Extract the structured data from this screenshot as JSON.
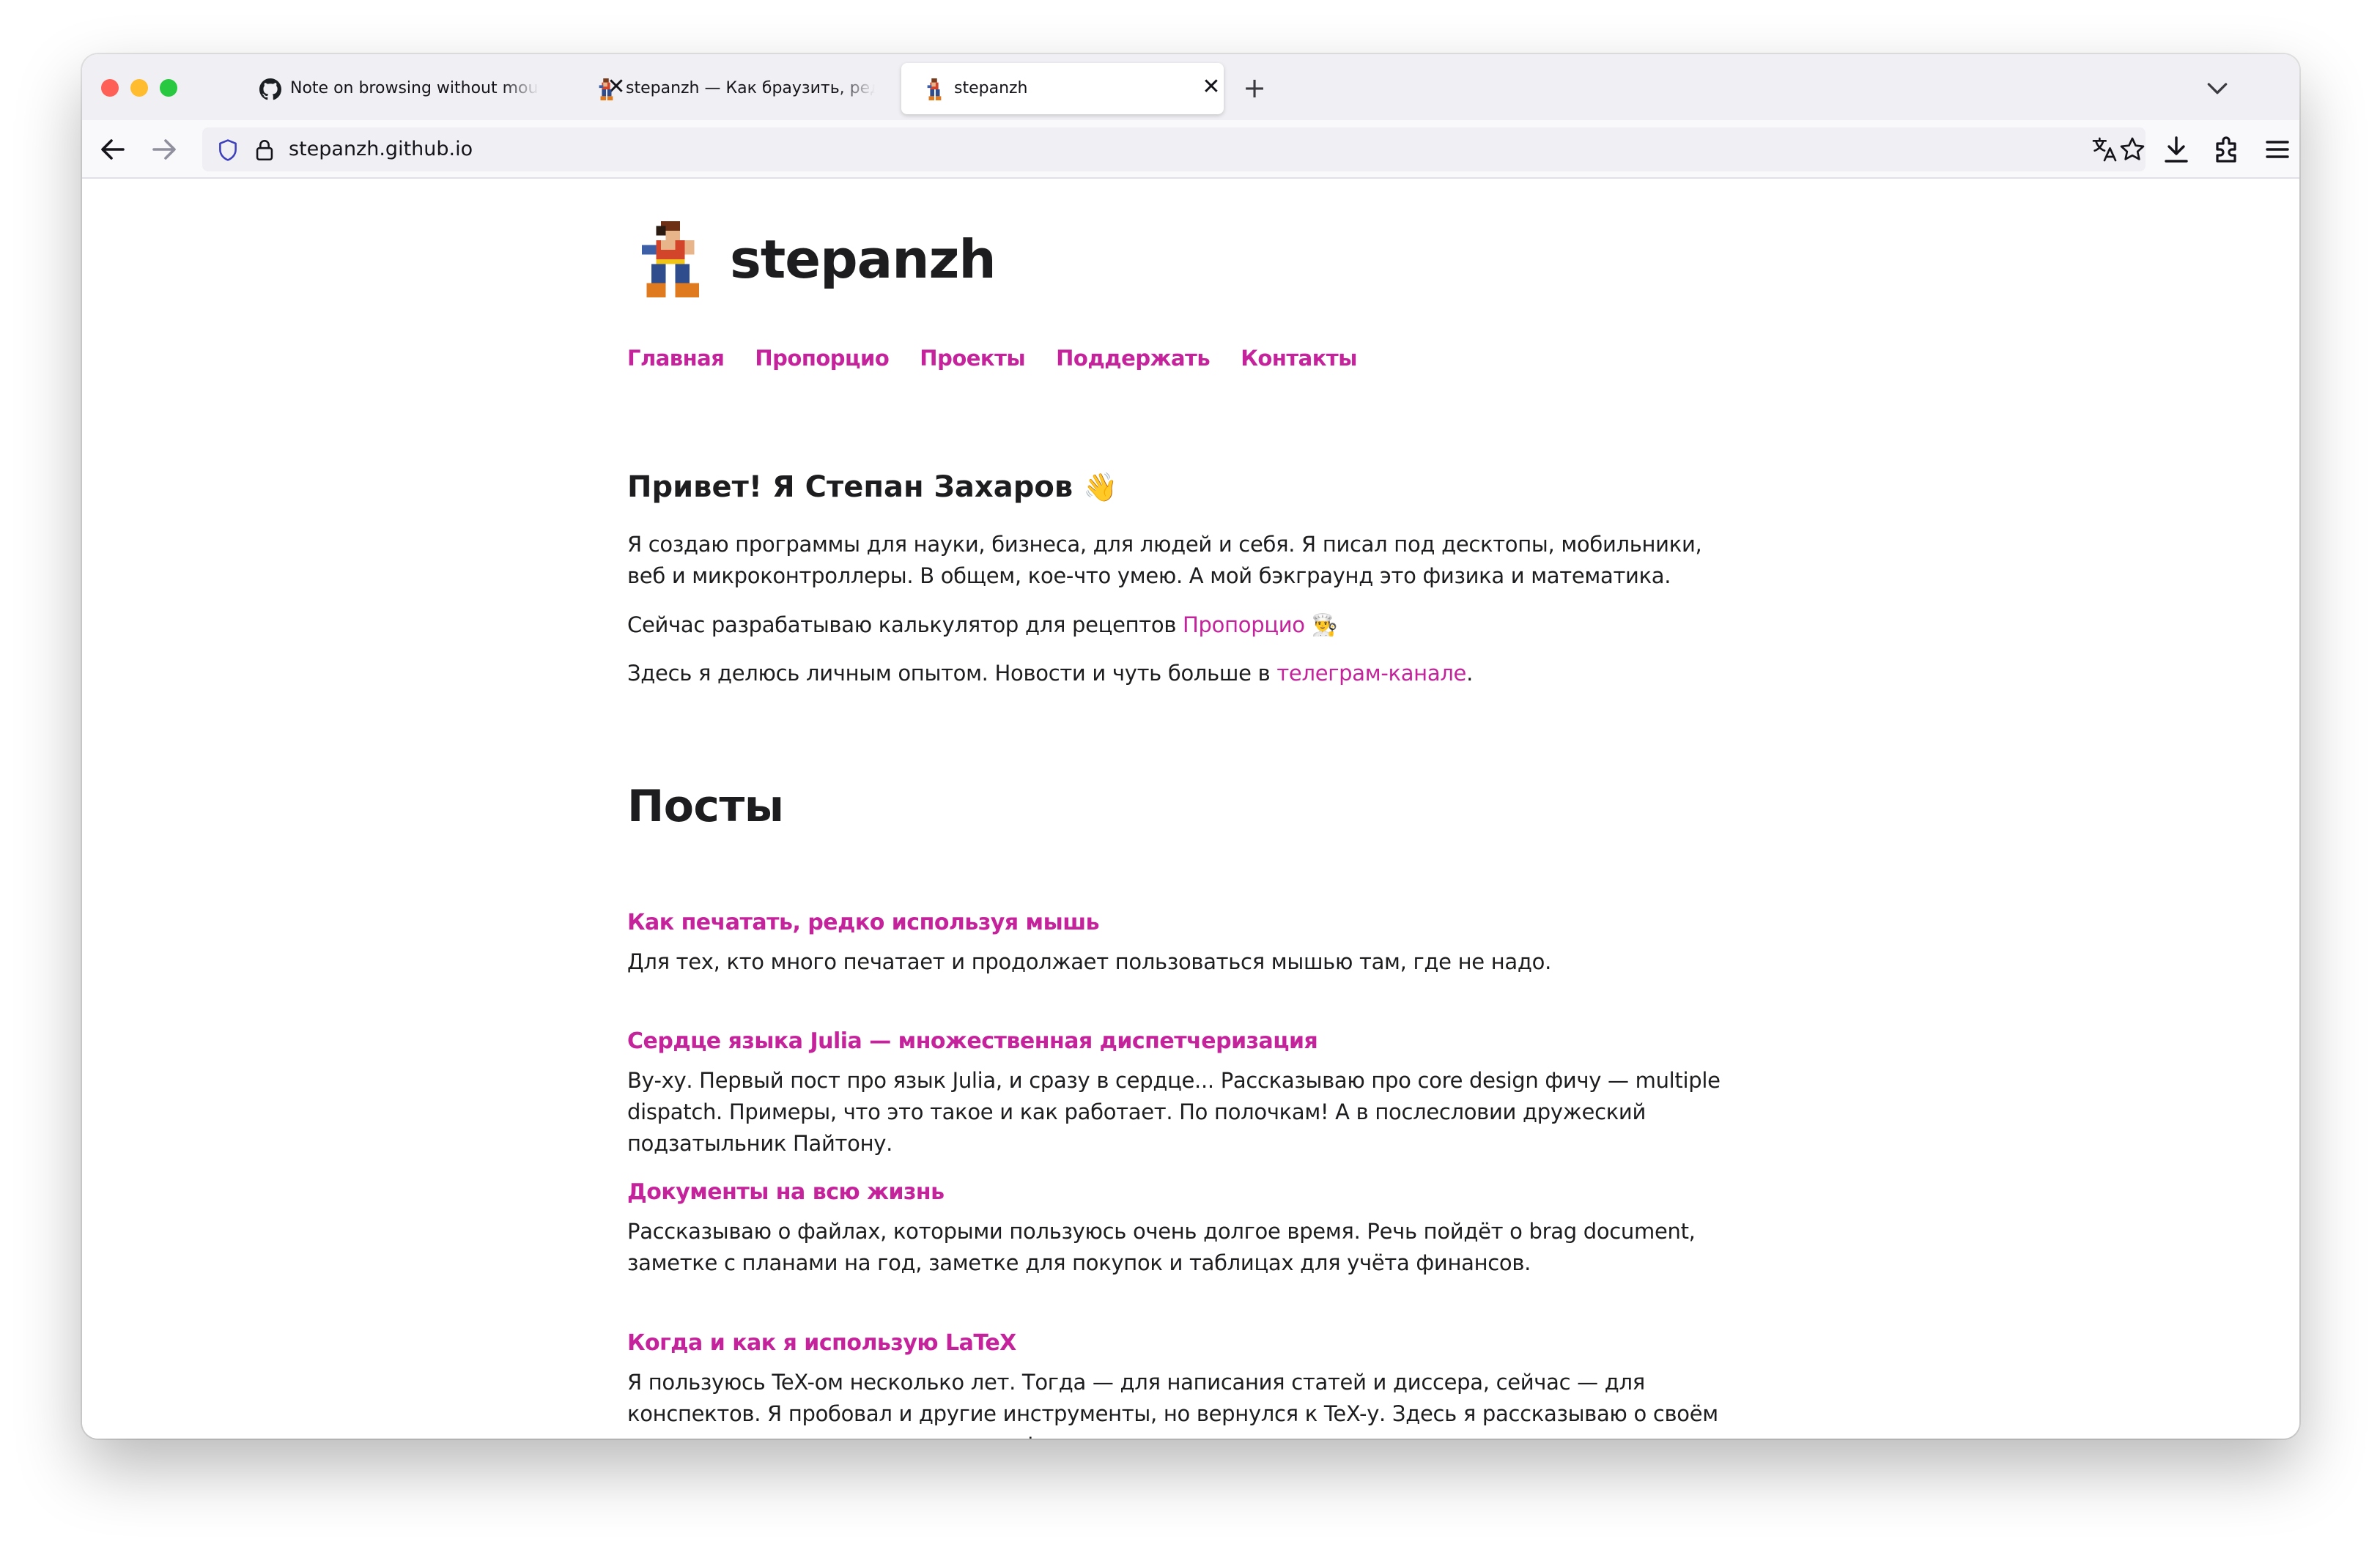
{
  "browser": {
    "tabs": [
      {
        "title": "Note on browsing without mouse",
        "icon": "github-icon"
      },
      {
        "title": "stepanzh — Как браузить, редко используя мышь",
        "icon": "site-favicon"
      },
      {
        "title": "stepanzh",
        "icon": "site-favicon"
      }
    ],
    "close_glyph": "✕",
    "new_tab_glyph": "+",
    "url": "stepanzh.github.io"
  },
  "site": {
    "title": "stepanzh",
    "nav": [
      "Главная",
      "Пропорцио",
      "Проекты",
      "Поддержать",
      "Контакты"
    ]
  },
  "intro": {
    "greeting": "Привет! Я Степан Захаров",
    "greeting_emoji": "👋",
    "p1": "Я создаю программы для науки, бизнеса, для людей и себя. Я писал под десктопы, мобильники, веб и микроконтроллеры. В общем, кое-что умею. А мой бэкграунд это физика и математика.",
    "p2_text": "Сейчас разрабатываю калькулятор для рецептов ",
    "p2_link": "Пропорцио",
    "p2_emoji": "👨‍🍳",
    "p3_text": "Здесь я делюсь личным опытом. Новости и чуть больше в ",
    "p3_link": "телеграм-канале",
    "p3_end": "."
  },
  "posts": {
    "heading": "Посты",
    "items": [
      {
        "title": "Как печатать, редко используя мышь",
        "desc": "Для тех, кто много печатает и продолжает пользоваться мышью там, где не надо."
      },
      {
        "title": "Сердце языка Julia — множественная диспетчеризация",
        "desc": "Ву-ху. Первый пост про язык Julia, и сразу в сердце... Рассказываю про core design фичу — multiple dispatch. Примеры, что это такое и как работает. По полочкам! А в послесловии дружеский подзатыльник Пайтону."
      },
      {
        "title": "Документы на всю жизнь",
        "desc": "Рассказываю о файлах, которыми пользуюсь очень долгое время. Речь пойдёт о brag document, заметке с планами на год, заметке для покупок и таблицах для учёта финансов."
      },
      {
        "title": "Когда и как я использую LaTeX",
        "desc": "Я пользуюсь TeX-ом несколько лет. Тогда — для написания статей и диссера, сейчас — для конспектов. Я пробовал и другие инструменты, но вернулся к TeX-у. Здесь я рассказываю о своём опыте и сетапе, с которым мне комфортно техать."
      }
    ]
  },
  "colors": {
    "link": "#c5239c",
    "text": "#1d1d1f",
    "chrome_bg": "#f0f0f4",
    "toolbar_bg": "#f9f9fb"
  }
}
